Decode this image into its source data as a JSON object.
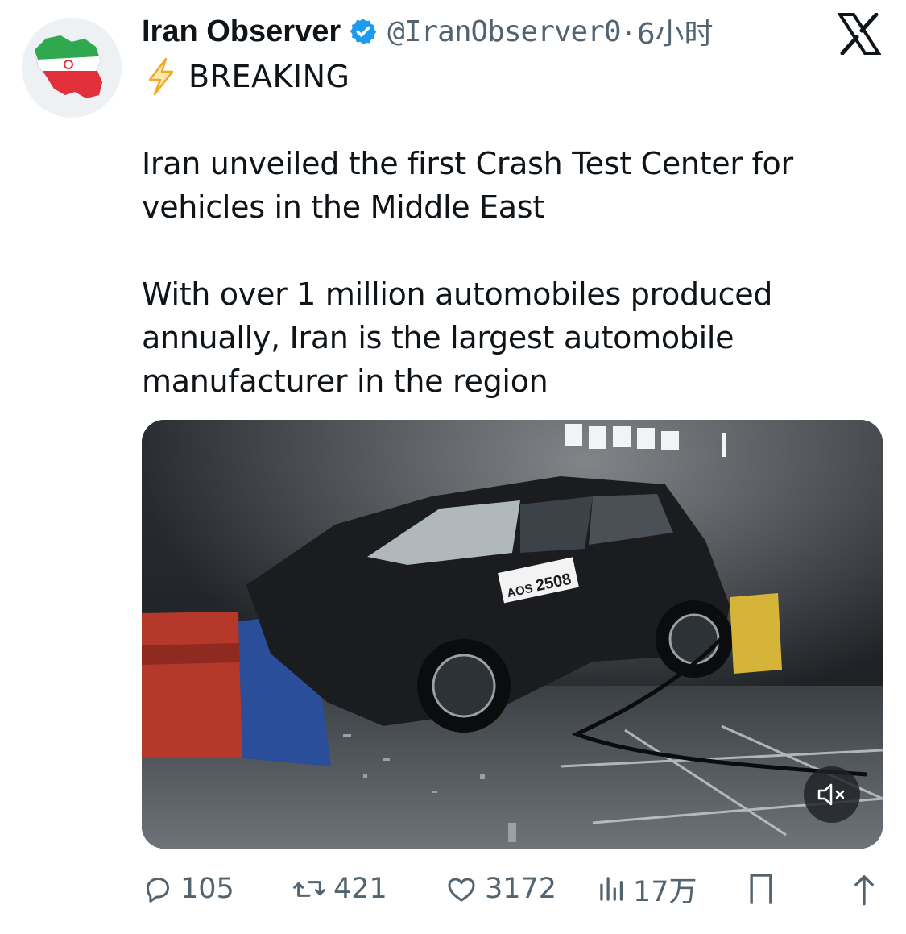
{
  "post": {
    "author_name": "Iran Observer",
    "handle": "@IranObserver0",
    "separator": "·",
    "time": "6小时",
    "label": "BREAKING",
    "paragraph1": "Iran unveiled the first Crash Test Center for vehicles in the Middle East",
    "paragraph2": "With over 1 million automobiles produced annually, Iran is the largest automobile manufacturer in the region"
  },
  "media": {
    "plate_prefix": "AOS",
    "plate_number": "2508"
  },
  "actions": {
    "replies": "105",
    "reposts": "421",
    "likes": "3172",
    "views": "17万"
  },
  "colors": {
    "text_primary": "#0f1419",
    "text_secondary": "#536471",
    "verified_blue": "#1d9bf0",
    "bolt_orange": "#f5a623"
  },
  "icons": [
    "x-logo-icon",
    "verified-badge-icon",
    "lightning-bolt-icon",
    "reply-icon",
    "repost-icon",
    "like-icon",
    "views-icon",
    "bookmark-icon",
    "share-icon",
    "mute-icon"
  ]
}
